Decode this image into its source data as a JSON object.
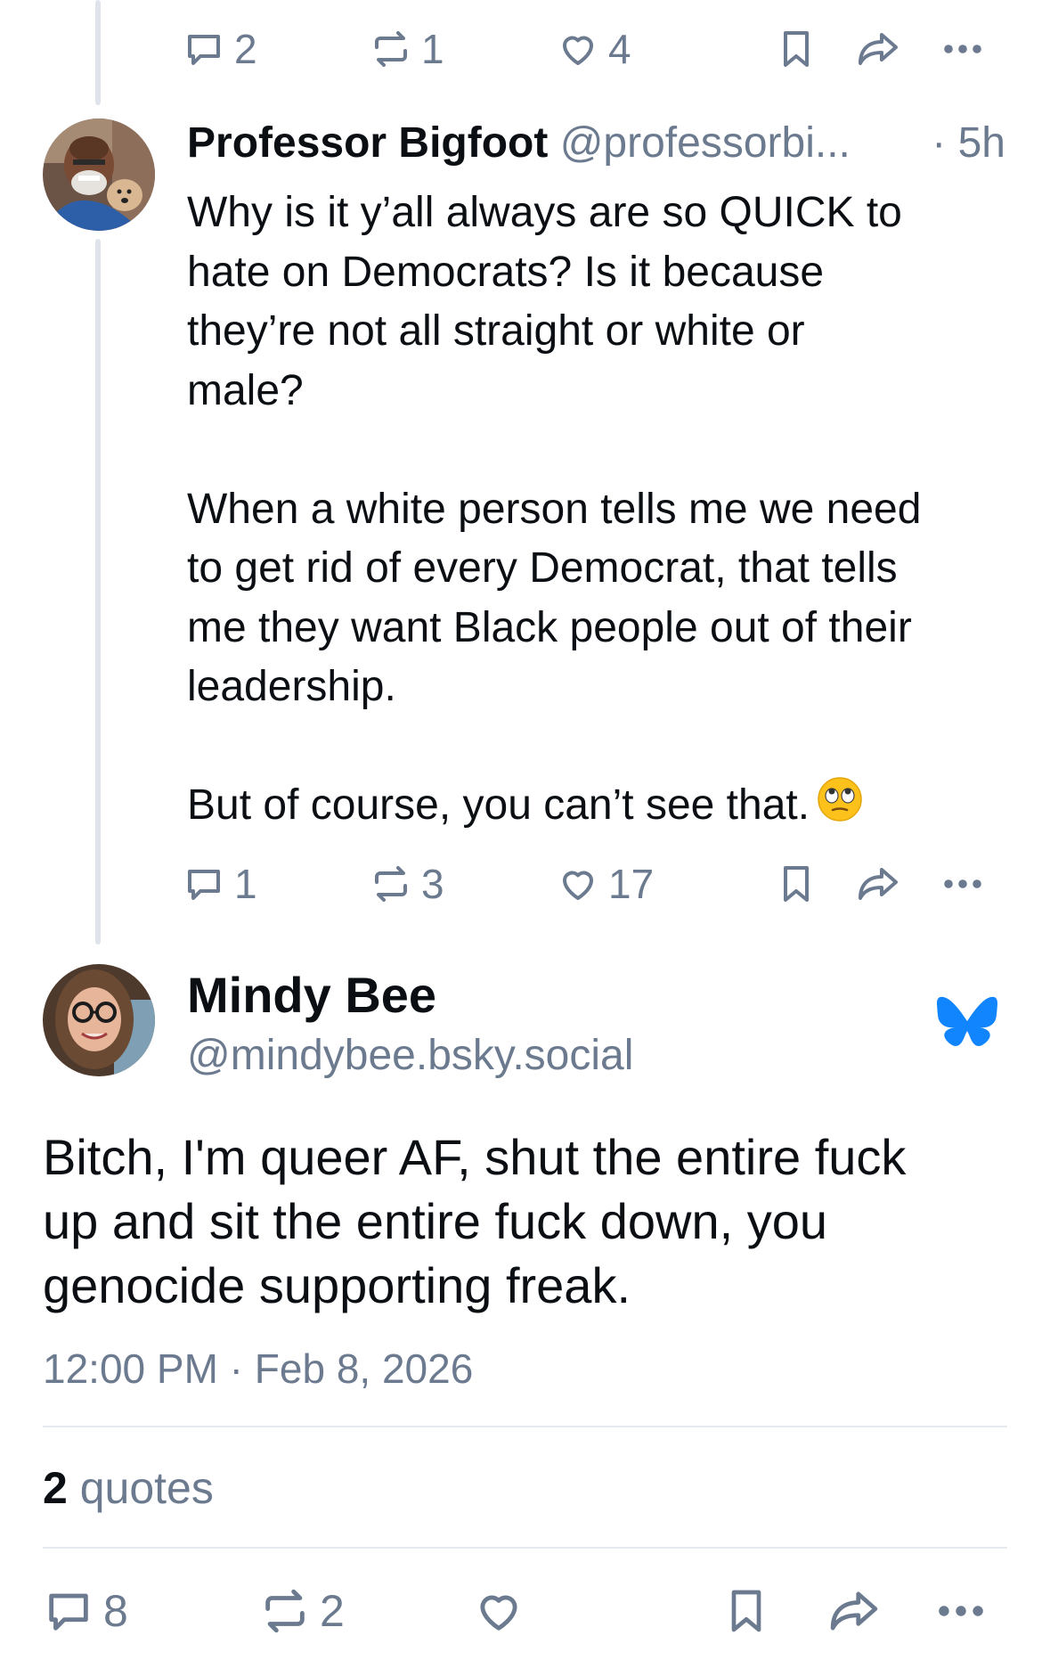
{
  "top_actions": {
    "replies": "2",
    "reposts": "1",
    "likes": "4"
  },
  "parent_post": {
    "author_name": "Professor Bigfoot",
    "author_handle": "@professorbi...",
    "time": "· 5h",
    "paragraphs": [
      [
        "Why is it y’all always are so QUICK to",
        "hate on Democrats? Is it because",
        "they’re not all straight or white or",
        "male?"
      ],
      [
        "When a white person tells me we need",
        "to get rid of every Democrat, that tells",
        "me they want Black people out of their",
        "leadership."
      ],
      [
        "But of course, you can’t see that."
      ]
    ],
    "emoji": "face-with-rolling-eyes",
    "replies": "1",
    "reposts": "3",
    "likes": "17"
  },
  "main_post": {
    "author_name": "Mindy Bee",
    "author_handle": "@mindybee.bsky.social",
    "lines": [
      "Bitch, I'm queer AF, shut the entire fuck",
      "up and sit the entire fuck down, you",
      "genocide supporting freak."
    ],
    "timestamp": "12:00 PM · Feb 8, 2026",
    "quotes_count": "2",
    "quotes_label": "quotes",
    "replies": "8",
    "reposts": "2"
  },
  "colors": {
    "muted": "#6b7a8f",
    "text": "#0b0f14",
    "bluesky": "#1185fe",
    "thread_line": "#dfe4ec"
  },
  "icons": [
    "reply-icon",
    "repost-icon",
    "like-icon",
    "bookmark-icon",
    "share-icon",
    "more-icon",
    "bluesky-butterfly-icon"
  ]
}
